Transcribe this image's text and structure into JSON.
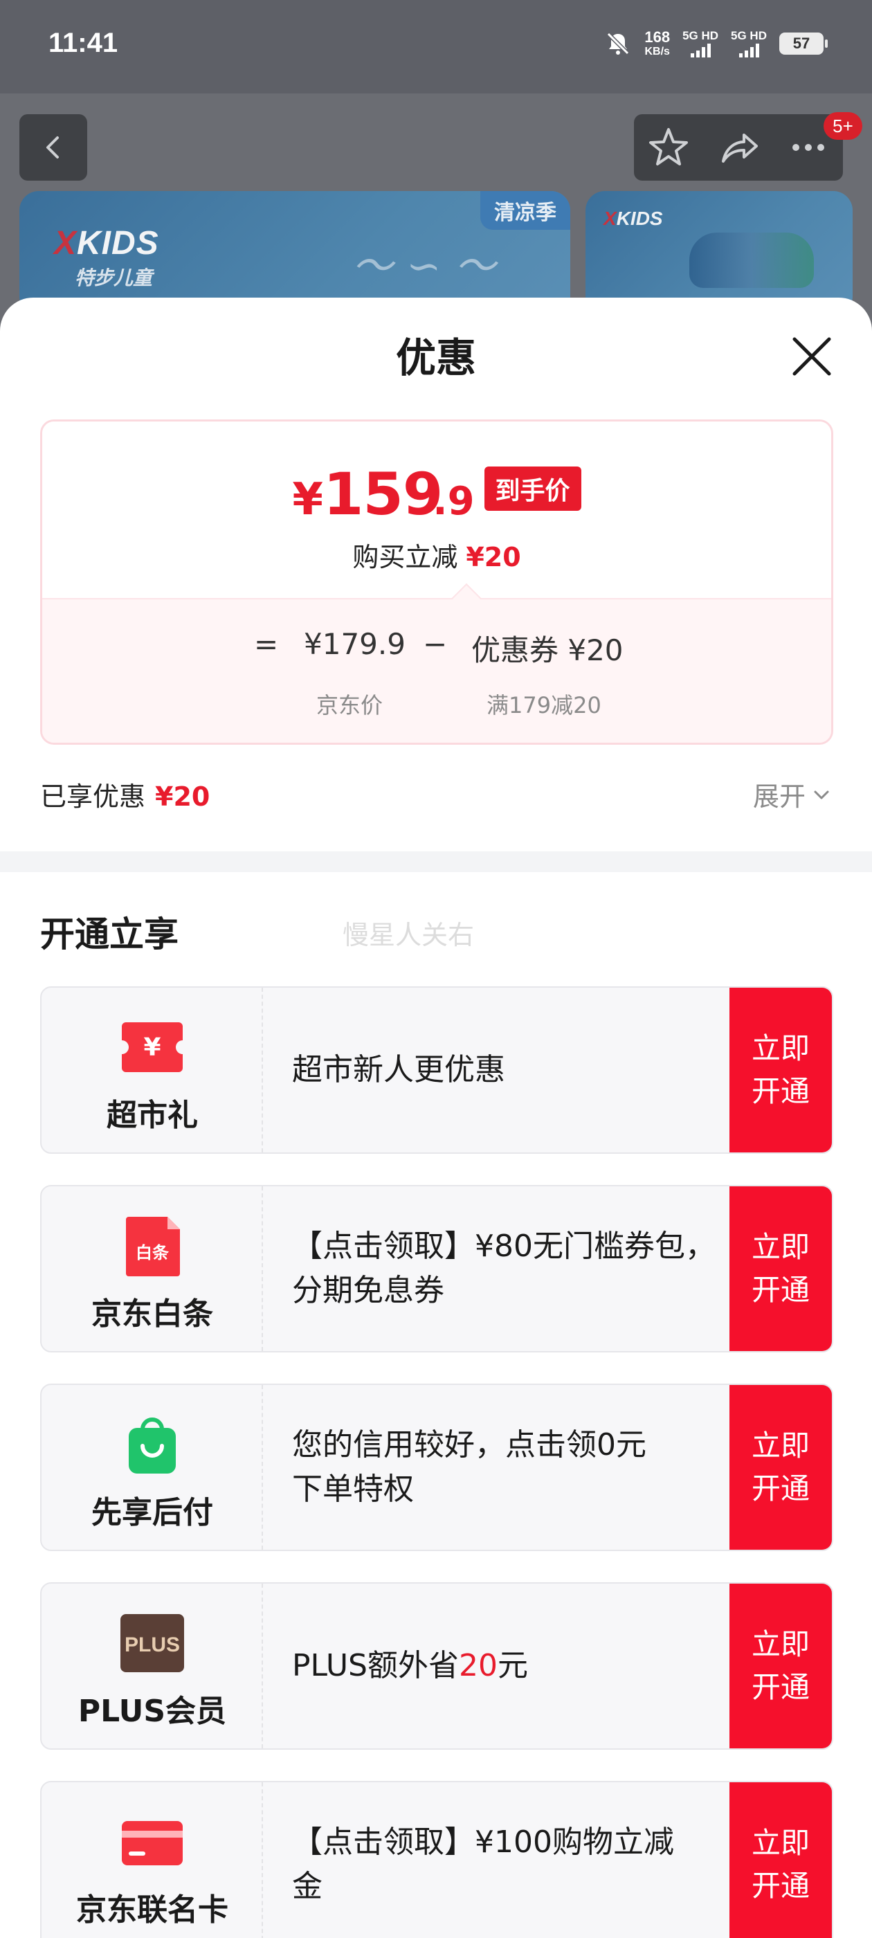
{
  "status_bar": {
    "time": "11:41",
    "net_speed_value": "168",
    "net_speed_unit": "KB/s",
    "sim1_label": "5G HD",
    "sim2_label": "5G HD",
    "battery": "57"
  },
  "background": {
    "cart_badge": "5+",
    "banner1_brand": "KIDS",
    "banner1_brand_x": "X",
    "banner1_sub": "特步儿童",
    "banner1_tag": "清凉季",
    "banner2_brand": "KIDS",
    "banner2_brand_x": "X"
  },
  "sheet": {
    "title": "优惠",
    "price": {
      "currency": "¥",
      "integer": "159",
      "decimal": ".9",
      "tag": "到手价",
      "reduce_label": "购买立减",
      "reduce_amount": "¥20"
    },
    "formula": {
      "equals": "=",
      "jd_price": "¥179.9",
      "minus": "−",
      "coupon": "优惠券 ¥20",
      "jd_price_label": "京东价",
      "coupon_label": "满179减20"
    },
    "enjoyed_label": "已享优惠",
    "enjoyed_amount": "¥20",
    "expand_label": "展开",
    "section_title": "开通立享",
    "watermark": "慢星人关右",
    "cards": [
      {
        "name": "超市礼",
        "desc": "超市新人更优惠",
        "btn1": "立即",
        "btn2": "开通",
        "icon": "supermarket-coupon-icon"
      },
      {
        "name": "京东白条",
        "desc_line1": "【点击领取】¥80无门槛券包，",
        "desc_line2": "分期免息券",
        "btn1": "立即",
        "btn2": "开通",
        "icon": "baitiao-icon",
        "icon_text": "白条"
      },
      {
        "name": "先享后付",
        "desc_line1": "您的信用较好，点击领0元",
        "desc_line2": "下单特权",
        "btn1": "立即",
        "btn2": "开通",
        "icon": "shopping-bag-icon"
      },
      {
        "name": "PLUS会员",
        "desc_pre": "PLUS额外省",
        "desc_hl": "20",
        "desc_post": "元",
        "btn1": "立即",
        "btn2": "开通",
        "icon": "plus-icon",
        "icon_text": "PLUS"
      },
      {
        "name": "京东联名卡",
        "desc_line1": "【点击领取】¥100购物立减",
        "desc_line2": "金",
        "btn1": "立即",
        "btn2": "开通",
        "icon": "credit-card-icon"
      }
    ]
  },
  "colors": {
    "accent_red": "#e81b2c",
    "button_red": "#f5102c",
    "plus_brown": "#5a3f36",
    "pay_green": "#20c46b"
  }
}
